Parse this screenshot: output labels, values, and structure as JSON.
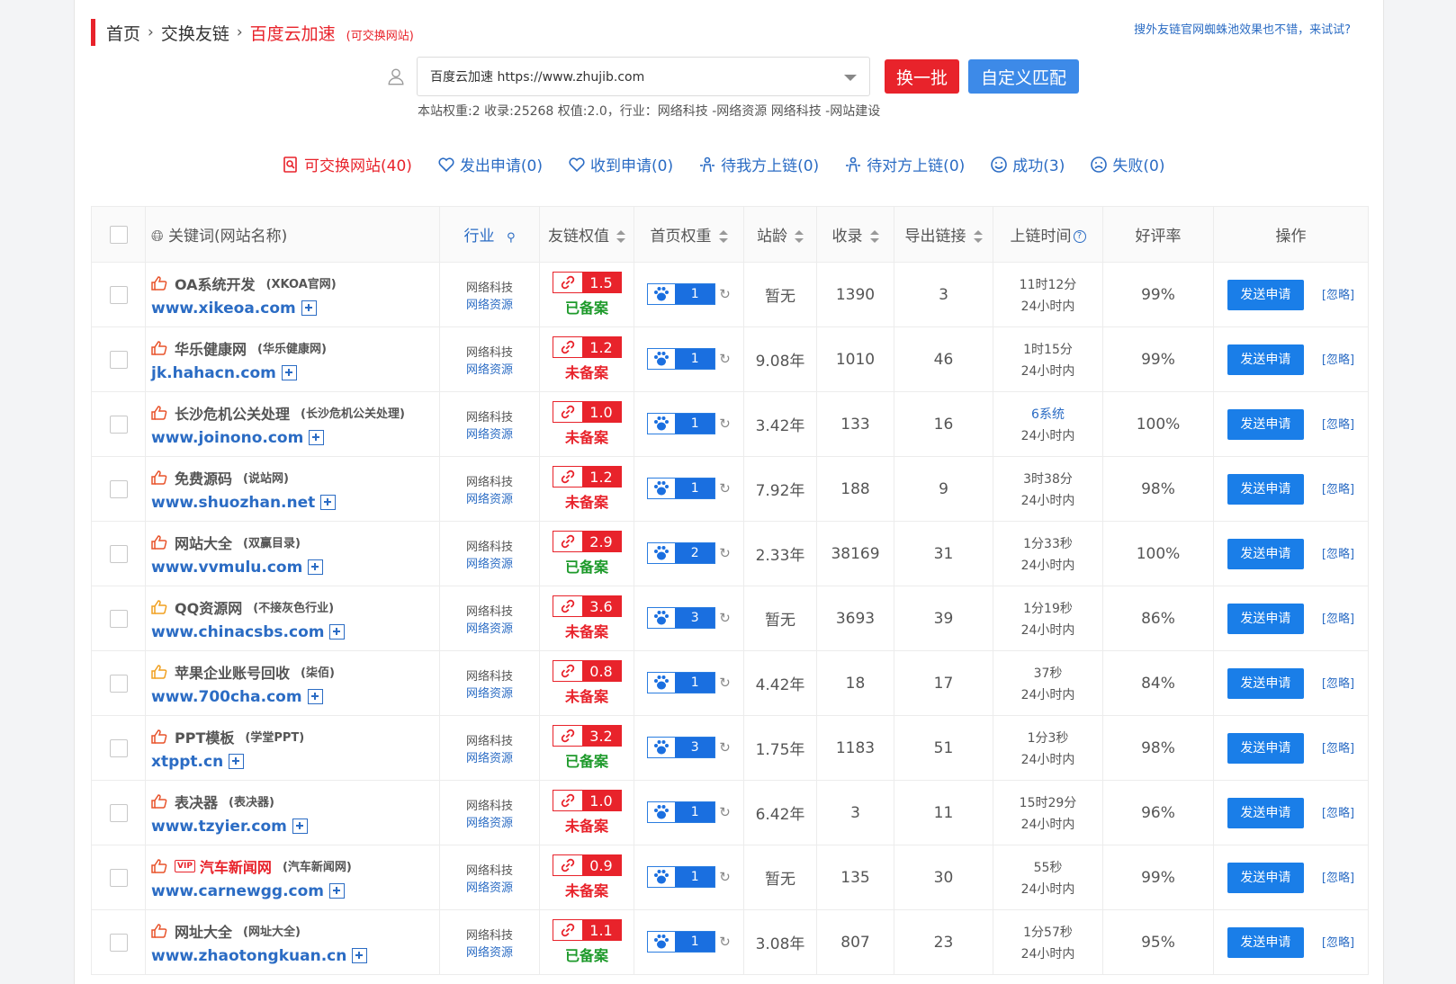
{
  "breadcrumb": {
    "home": "首页",
    "section": "交换友链",
    "current": "百度云加速",
    "tag": "(可交换网站)"
  },
  "try_link": "搜外友链官网蜘蛛池效果也不错，来试试?",
  "site_select": {
    "value": "百度云加速 https://www.zhujib.com"
  },
  "buttons": {
    "refresh": "换一批",
    "custom": "自定义匹配",
    "send": "发送申请",
    "ignore": "[忽略]"
  },
  "site_info": "本站权重:2 收录:25268 权值:2.0，行业：网络科技 -网络资源 网络科技 -网站建设",
  "tabs": [
    {
      "label": "可交换网站(40)",
      "icon": "search-doc-icon",
      "active": true
    },
    {
      "label": "发出申请(0)",
      "icon": "heart-out-icon"
    },
    {
      "label": "收到申请(0)",
      "icon": "heart-in-icon"
    },
    {
      "label": "待我方上链(0)",
      "icon": "person-link-icon"
    },
    {
      "label": "待对方上链(0)",
      "icon": "person-link-icon"
    },
    {
      "label": "成功(3)",
      "icon": "smile-icon"
    },
    {
      "label": "失败(0)",
      "icon": "sad-icon"
    }
  ],
  "columns": {
    "keyword": "关键词(网站名称)",
    "industry": "行业",
    "weight": "友链权值",
    "br": "首页权重",
    "age": "站龄",
    "indexed": "收录",
    "outlinks": "导出链接",
    "uptime": "上链时间",
    "rating": "好评率",
    "ops": "操作"
  },
  "colors": {
    "accent_red": "#e8232b",
    "accent_blue": "#2b6cc4",
    "btn_blue": "#1a7ee8",
    "green": "#1e9a2b"
  },
  "rows": [
    {
      "title": "OA系统开发",
      "sub": "(XKOA官网)",
      "url": "www.xikeoa.com",
      "ind1": "网络科技",
      "ind2": "网络资源",
      "weight": "1.5",
      "status": "已备案",
      "ok": true,
      "br": "1",
      "age": "暂无",
      "indexed": "1390",
      "out": "3",
      "t1": "11时12分",
      "t2": "24小时内",
      "rate": "99%"
    },
    {
      "title": "华乐健康网",
      "sub": "(华乐健康网)",
      "url": "jk.hahacn.com",
      "ind1": "网络科技",
      "ind2": "网络资源",
      "weight": "1.2",
      "status": "未备案",
      "ok": false,
      "br": "1",
      "age": "9.08年",
      "indexed": "1010",
      "out": "46",
      "t1": "1时15分",
      "t2": "24小时内",
      "rate": "99%"
    },
    {
      "title": "长沙危机公关处理",
      "sub": "(长沙危机公关处理)",
      "url": "www.joinono.com",
      "ind1": "网络科技",
      "ind2": "网络资源",
      "weight": "1.0",
      "status": "未备案",
      "ok": false,
      "br": "1",
      "age": "3.42年",
      "indexed": "133",
      "out": "16",
      "t1": "6系统",
      "t1blue": true,
      "t2": "24小时内",
      "rate": "100%"
    },
    {
      "title": "免费源码",
      "sub": "(说站网)",
      "url": "www.shuozhan.net",
      "ind1": "网络科技",
      "ind2": "网络资源",
      "weight": "1.2",
      "status": "未备案",
      "ok": false,
      "br": "1",
      "age": "7.92年",
      "indexed": "188",
      "out": "9",
      "t1": "3时38分",
      "t2": "24小时内",
      "rate": "98%"
    },
    {
      "title": "网站大全",
      "sub": "(双赢目录)",
      "url": "www.vvmulu.com",
      "ind1": "网络科技",
      "ind2": "网络资源",
      "weight": "2.9",
      "status": "已备案",
      "ok": true,
      "br": "2",
      "age": "2.33年",
      "indexed": "38169",
      "out": "31",
      "t1": "1分33秒",
      "t2": "24小时内",
      "rate": "100%"
    },
    {
      "title": "QQ资源网",
      "sub": "(不接灰色行业)",
      "url": "www.chinacsbs.com",
      "ind1": "网络科技",
      "ind2": "网络资源",
      "weight": "3.6",
      "status": "未备案",
      "ok": false,
      "br": "3",
      "age": "暂无",
      "indexed": "3693",
      "out": "39",
      "t1": "1分19秒",
      "t2": "24小时内",
      "rate": "86%",
      "thumbYellow": true
    },
    {
      "title": "苹果企业账号回收",
      "sub": "(柒佰)",
      "url": "www.700cha.com",
      "ind1": "网络科技",
      "ind2": "网络资源",
      "weight": "0.8",
      "status": "未备案",
      "ok": false,
      "br": "1",
      "age": "4.42年",
      "indexed": "18",
      "out": "17",
      "t1": "37秒",
      "t2": "24小时内",
      "rate": "84%",
      "thumbYellow": true
    },
    {
      "title": "PPT模板",
      "sub": "(学堂PPT)",
      "url": "xtppt.cn",
      "ind1": "网络科技",
      "ind2": "网络资源",
      "weight": "3.2",
      "status": "已备案",
      "ok": true,
      "br": "3",
      "age": "1.75年",
      "indexed": "1183",
      "out": "51",
      "outRed": true,
      "t1": "1分3秒",
      "t2": "24小时内",
      "rate": "98%"
    },
    {
      "title": "表决器",
      "sub": "(表决器)",
      "url": "www.tzyier.com",
      "ind1": "网络科技",
      "ind2": "网络资源",
      "weight": "1.0",
      "status": "未备案",
      "ok": false,
      "br": "1",
      "age": "6.42年",
      "indexed": "3",
      "out": "11",
      "t1": "15时29分",
      "t2": "24小时内",
      "rate": "96%"
    },
    {
      "title": "汽车新闻网",
      "sub": "(汽车新闻网)",
      "url": "www.carnewgg.com",
      "ind1": "网络科技",
      "ind2": "网络资源",
      "weight": "0.9",
      "status": "未备案",
      "ok": false,
      "br": "1",
      "age": "暂无",
      "indexed": "135",
      "out": "30",
      "t1": "55秒",
      "t2": "24小时内",
      "rate": "99%",
      "vip": "VIP",
      "hot": true
    },
    {
      "title": "网址大全",
      "sub": "(网址大全)",
      "url": "www.zhaotongkuan.cn",
      "ind1": "网络科技",
      "ind2": "网络资源",
      "weight": "1.1",
      "status": "已备案",
      "ok": true,
      "br": "1",
      "age": "3.08年",
      "indexed": "807",
      "out": "23",
      "t1": "1分57秒",
      "t2": "24小时内",
      "rate": "95%"
    }
  ]
}
